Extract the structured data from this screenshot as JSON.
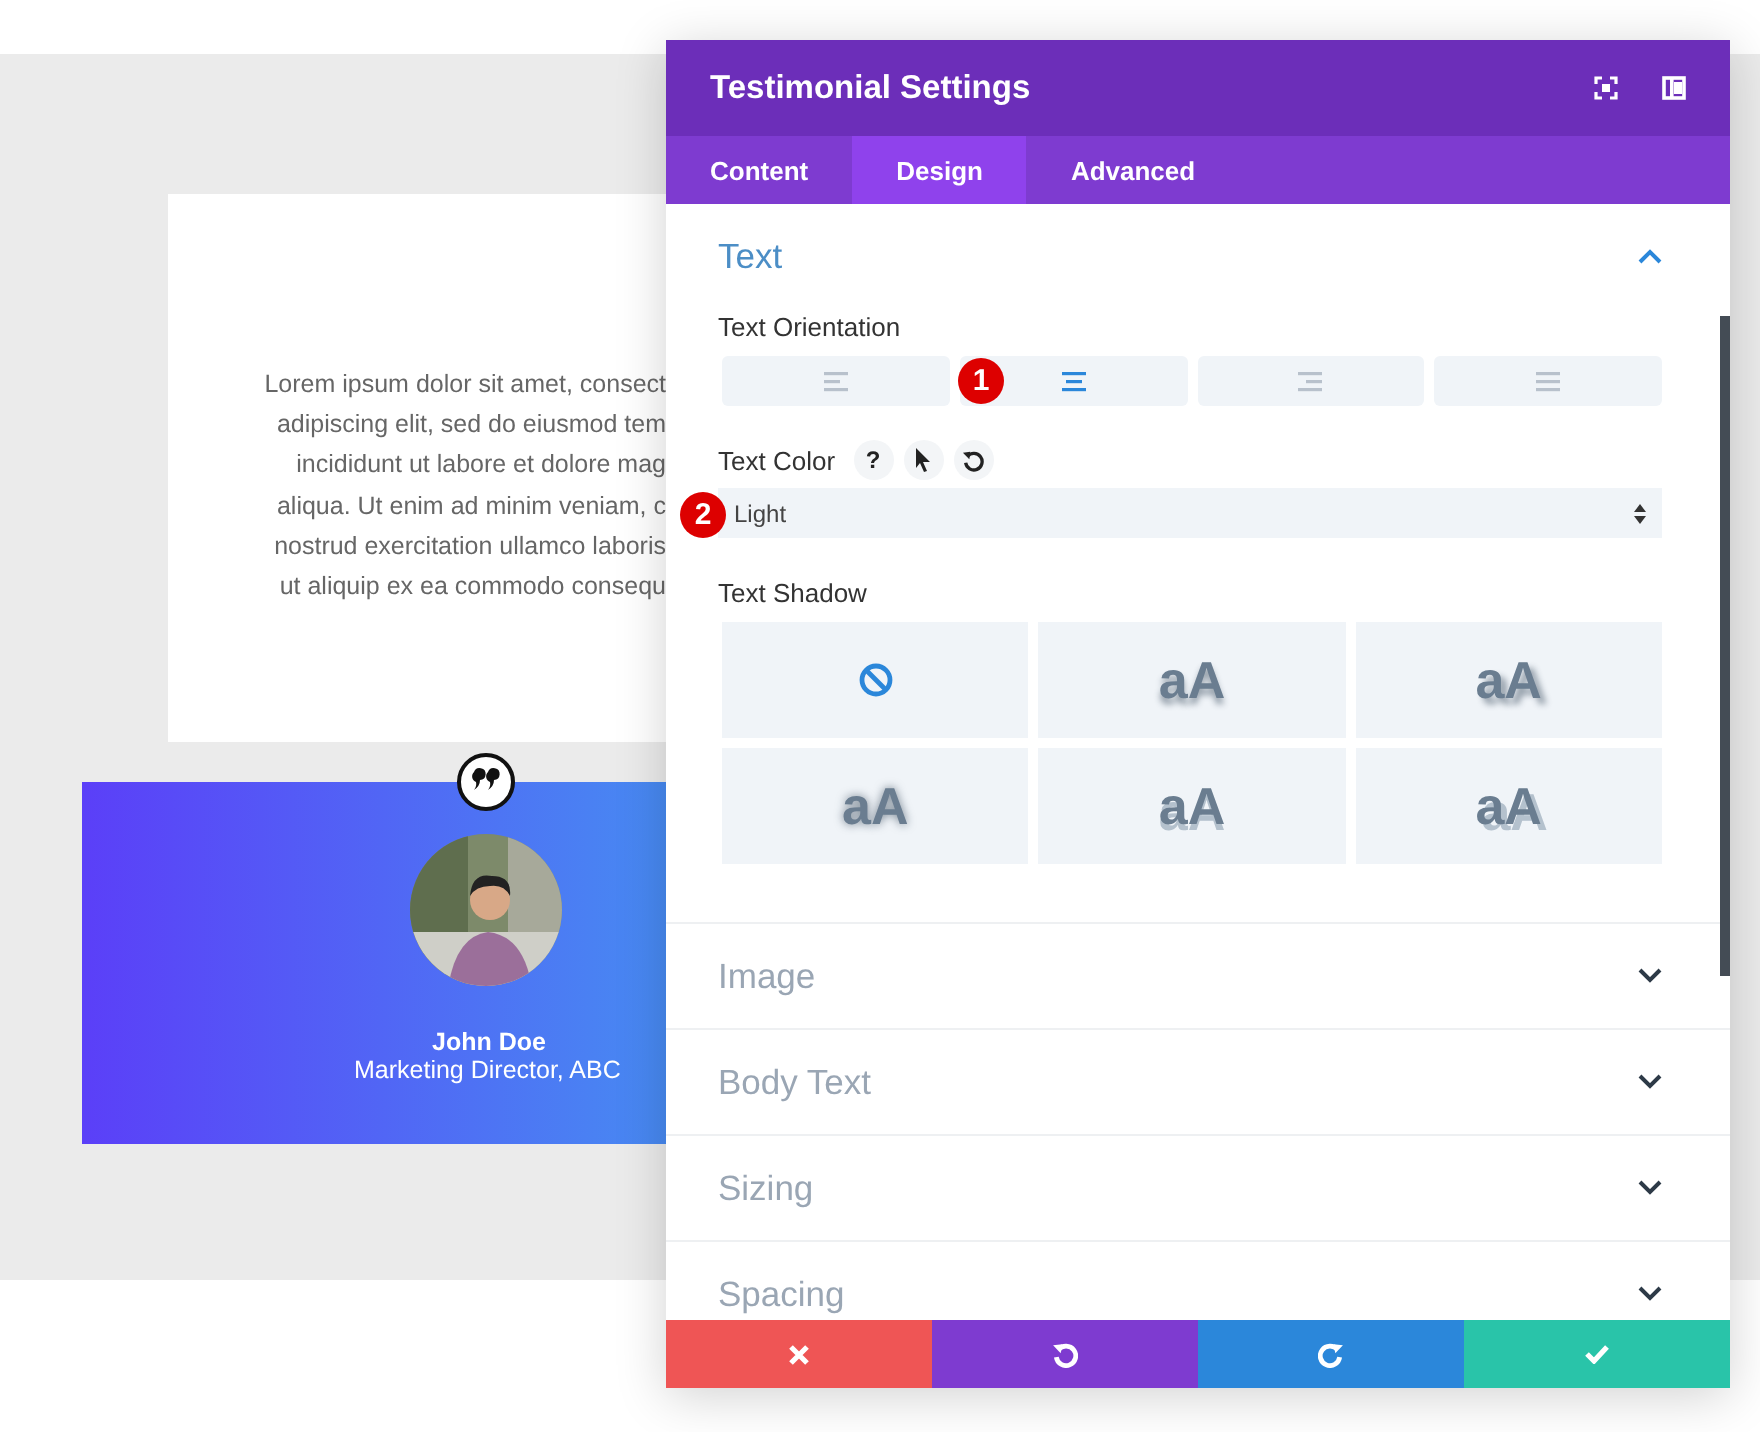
{
  "preview": {
    "body_lines": [
      "Lorem ipsum dolor sit amet, consect",
      "adipiscing elit, sed do eiusmod tem",
      "incididunt ut labore et dolore mag",
      "aliqua. Ut enim ad minim veniam, c",
      "nostrud exercitation ullamco laboris",
      "ut aliquip ex ea commodo consequ"
    ],
    "author": {
      "name": "John Doe",
      "role": "Marketing Director, ABC"
    }
  },
  "panel": {
    "title": "Testimonial Settings",
    "tabs": [
      {
        "label": "Content",
        "selected": false
      },
      {
        "label": "Design",
        "selected": true
      },
      {
        "label": "Advanced",
        "selected": false
      }
    ],
    "section": {
      "title": "Text",
      "expanded": true,
      "orientation": {
        "label": "Text Orientation",
        "badge": "1",
        "options": [
          {
            "kind": "left",
            "selected": false
          },
          {
            "kind": "center",
            "selected": true
          },
          {
            "kind": "right",
            "selected": false
          },
          {
            "kind": "justify",
            "selected": false
          }
        ]
      },
      "color": {
        "label": "Text Color",
        "help": "?",
        "badge": "2",
        "value": "Light"
      },
      "shadow": {
        "label": "Text Shadow",
        "options": [
          {
            "kind": "none",
            "selected": true
          },
          {
            "kind": "preset",
            "text": "aA",
            "selected": false
          },
          {
            "kind": "preset",
            "text": "aA",
            "selected": false
          },
          {
            "kind": "preset",
            "text": "aA",
            "selected": false
          },
          {
            "kind": "preset",
            "text": "aA",
            "selected": false
          },
          {
            "kind": "preset",
            "text": "aA",
            "selected": false
          }
        ]
      }
    },
    "collapsed": [
      {
        "title": "Image",
        "expanded": false
      },
      {
        "title": "Body Text",
        "expanded": false
      },
      {
        "title": "Sizing",
        "expanded": false
      },
      {
        "title": "Spacing",
        "expanded": false
      }
    ],
    "actions": [
      {
        "kind": "cancel"
      },
      {
        "kind": "undo"
      },
      {
        "kind": "redo"
      },
      {
        "kind": "save"
      }
    ]
  }
}
